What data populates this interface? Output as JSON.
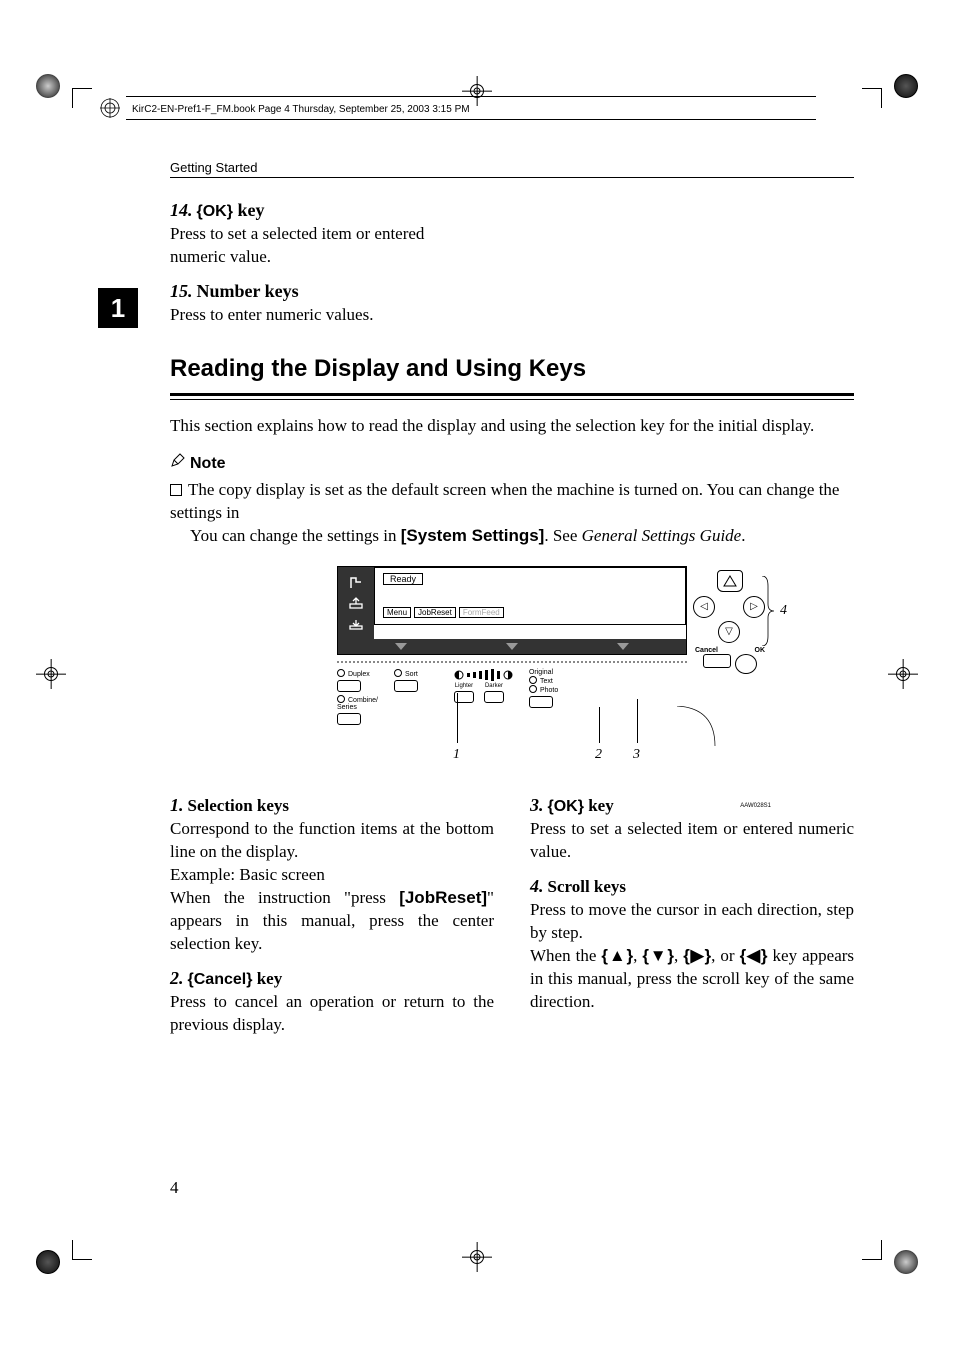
{
  "doc_path": "KirC2-EN-Pref1-F_FM.book  Page 4  Thursday, September 25, 2003  3:15 PM",
  "section_header": "Getting Started",
  "chapter_tab": "1",
  "page_number": "4",
  "top_items": {
    "i14": {
      "num": "14.",
      "key": "OK",
      "suffix": " key",
      "body": "Press to set a selected item or entered numeric value."
    },
    "i15": {
      "num": "15.",
      "title": "Number keys",
      "body": "Press to enter numeric values."
    }
  },
  "h2": "Reading the Display and Using Keys",
  "intro": "This section explains how to read the display and using the selection key for the initial display.",
  "note_label": "Note",
  "note_body_pre": "The copy display is set as the default screen when the machine is turned on. You can change the settings in ",
  "note_sys": "[System Settings]",
  "note_body_mid": ". See ",
  "note_ref": "General Settings Guide",
  "note_body_post": ".",
  "diagram": {
    "ready": "Ready",
    "menu": "Menu",
    "jobreset": "JobReset",
    "formfeed": "FormFeed",
    "cancel": "Cancel",
    "ok": "OK",
    "duplex": "Duplex",
    "combine": "Combine/\nSeries",
    "sort": "Sort",
    "lighter": "Lighter",
    "darker": "Darker",
    "original": "Original",
    "text": "Text",
    "photo": "Photo",
    "call1": "1",
    "call2": "2",
    "call3": "3",
    "call4": "4",
    "code": "AAW028S1"
  },
  "cols": {
    "left": {
      "i1": {
        "num": "1.",
        "title": "Selection keys",
        "p1": "Correspond to the function items at the bottom line on the display.",
        "p2": "Example: Basic screen",
        "p3_pre": "When the instruction \"press ",
        "p3_key": "[JobReset]",
        "p3_post": "\" appears in this manual, press the center selection key."
      },
      "i2": {
        "num": "2.",
        "key": "Cancel",
        "suffix": " key",
        "body": "Press to cancel an operation or return to the previous display."
      }
    },
    "right": {
      "i3": {
        "num": "3.",
        "key": "OK",
        "suffix": " key",
        "body": "Press to set a selected item or entered numeric value."
      },
      "i4": {
        "num": "4.",
        "title": "Scroll keys",
        "p1": "Press to move the cursor in each direction, step by step.",
        "p2_pre": "When the ",
        "p2_keys": [
          "▲",
          "▼",
          "▶",
          "◀"
        ],
        "p2_mid1": ", ",
        "p2_mid2": ", ",
        "p2_mid3": ", or ",
        "p2_post": " key appears in this manual, press the scroll key of the same direction."
      }
    }
  }
}
